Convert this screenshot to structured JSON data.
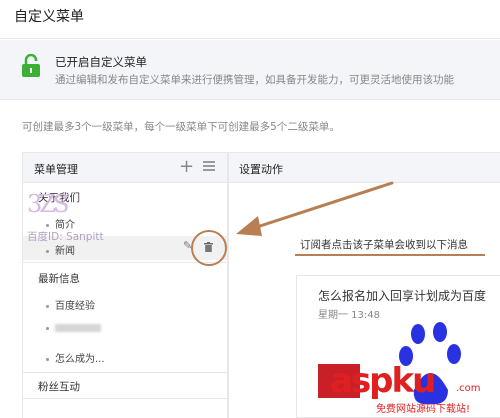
{
  "header": {
    "title": "自定义菜单"
  },
  "notice": {
    "title": "已开启自定义菜单",
    "description": "通过编辑和发布自定义菜单来进行便携管理，如具备开发能力，可更灵活地使用该功能"
  },
  "hint": "可创建最多3个一级菜单，每个一级菜单下可创建最多5个二级菜单。",
  "menu_panel": {
    "title": "菜单管理",
    "groups": [
      {
        "label": "关于我们",
        "children": [
          "简介",
          "新闻"
        ]
      },
      {
        "label": "最新信息",
        "children": [
          "百度经验",
          "",
          "怎么成为..."
        ]
      },
      {
        "label": "粉丝互动",
        "children": []
      }
    ]
  },
  "watermark": {
    "logo": "3ZS",
    "text": "百度ID: Sanpitt"
  },
  "action_panel": {
    "title": "设置动作",
    "message_label": "订阅者点击该子菜单会收到以下消息",
    "card": {
      "title": "怎么报名加入回享计划成为百度",
      "date": "星期一 13:48"
    }
  },
  "site_watermark": {
    "brand": "aspku",
    "tail": ".com",
    "sub": "免费网站源码下载站!"
  },
  "colors": {
    "accent": "#b88052",
    "lock_green": "#3cb034",
    "paw_blue": "#2932e1",
    "brand_red": "#e02020"
  }
}
